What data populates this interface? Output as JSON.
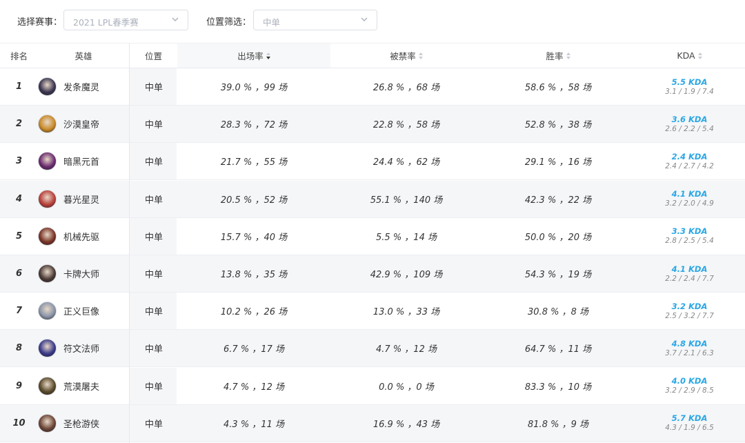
{
  "filters": {
    "event_label": "选择赛事：",
    "event_value": "2021 LPL春季赛",
    "position_label": "位置筛选：",
    "position_value": "中单"
  },
  "columns": {
    "rank": "排名",
    "hero": "英雄",
    "position": "位置",
    "pick_rate": "出场率",
    "ban_rate": "被禁率",
    "win_rate": "胜率",
    "kda": "KDA"
  },
  "colors": {
    "kda_accent": "#2aa7e5",
    "row_alt_bg": "#f5f6f8"
  },
  "rows": [
    {
      "rank": "1",
      "hero": "发条魔灵",
      "position": "中单",
      "pick": "39.0 % ，99 场",
      "ban": "26.8 % ，68 场",
      "win": "58.6 % ，58 场",
      "kda": "5.5 KDA",
      "kda_detail": "3.1 / 1.9 / 7.4",
      "avatar_color": "#3b3650"
    },
    {
      "rank": "2",
      "hero": "沙漠皇帝",
      "position": "中单",
      "pick": "28.3 % ，72 场",
      "ban": "22.8 % ，58 场",
      "win": "52.8 % ，38 场",
      "kda": "3.6 KDA",
      "kda_detail": "2.6 / 2.2 / 5.4",
      "avatar_color": "#c98a2a"
    },
    {
      "rank": "3",
      "hero": "暗黑元首",
      "position": "中单",
      "pick": "21.7 % ，55 场",
      "ban": "24.4 % ，62 场",
      "win": "29.1 % ，16 场",
      "kda": "2.4 KDA",
      "kda_detail": "2.4 / 2.7 / 4.2",
      "avatar_color": "#6a2b6f"
    },
    {
      "rank": "4",
      "hero": "暮光星灵",
      "position": "中单",
      "pick": "20.5 % ，52 场",
      "ban": "55.1 % ，140 场",
      "win": "42.3 % ，22 场",
      "kda": "4.1 KDA",
      "kda_detail": "3.2 / 2.0 / 4.9",
      "avatar_color": "#b8403a"
    },
    {
      "rank": "5",
      "hero": "机械先驱",
      "position": "中单",
      "pick": "15.7 % ，40 场",
      "ban": "5.5 % ，14 场",
      "win": "50.0 % ，20 场",
      "kda": "3.3 KDA",
      "kda_detail": "2.8 / 2.5 / 5.4",
      "avatar_color": "#7a3426"
    },
    {
      "rank": "6",
      "hero": "卡牌大师",
      "position": "中单",
      "pick": "13.8 % ，35 场",
      "ban": "42.9 % ，109 场",
      "win": "54.3 % ，19 场",
      "kda": "4.1 KDA",
      "kda_detail": "2.2 / 2.4 / 7.7",
      "avatar_color": "#4a3a35"
    },
    {
      "rank": "7",
      "hero": "正义巨像",
      "position": "中单",
      "pick": "10.2 % ，26 场",
      "ban": "13.0 % ，33 场",
      "win": "30.8 % ，8 场",
      "kda": "3.2 KDA",
      "kda_detail": "2.5 / 3.2 / 7.7",
      "avatar_color": "#8a95a8"
    },
    {
      "rank": "8",
      "hero": "符文法师",
      "position": "中单",
      "pick": "6.7 % ，17 场",
      "ban": "4.7 % ，12 场",
      "win": "64.7 % ，11 场",
      "kda": "4.8 KDA",
      "kda_detail": "3.7 / 2.1 / 6.3",
      "avatar_color": "#3a3a8a"
    },
    {
      "rank": "9",
      "hero": "荒漠屠夫",
      "position": "中单",
      "pick": "4.7 % ，12 场",
      "ban": "0.0 % ，0 场",
      "win": "83.3 % ，10 场",
      "kda": "4.0 KDA",
      "kda_detail": "3.2 / 2.9 / 8.5",
      "avatar_color": "#5a4a2a"
    },
    {
      "rank": "10",
      "hero": "圣枪游侠",
      "position": "中单",
      "pick": "4.3 % ，11 场",
      "ban": "16.9 % ，43 场",
      "win": "81.8 % ，9 场",
      "kda": "5.7 KDA",
      "kda_detail": "4.3 / 1.9 / 6.5",
      "avatar_color": "#6b4436"
    }
  ]
}
